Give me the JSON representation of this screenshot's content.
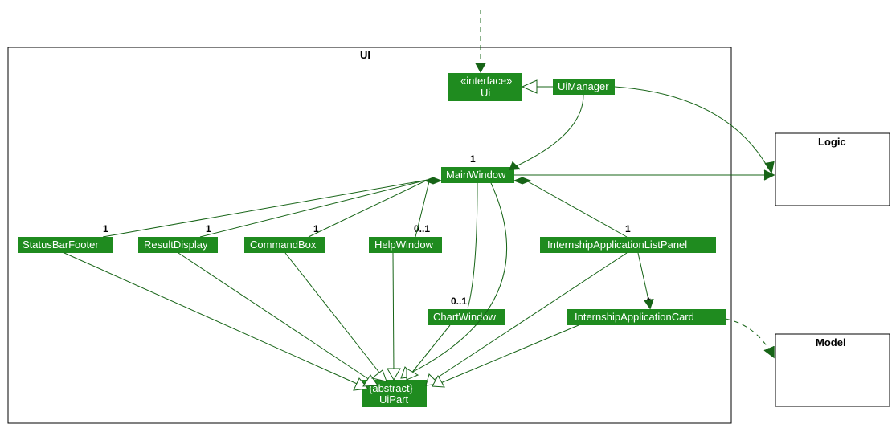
{
  "packages": {
    "ui": "UI",
    "logic": "Logic",
    "model": "Model"
  },
  "nodes": {
    "uiInterface": {
      "stereotype": "«interface»",
      "name": "Ui"
    },
    "uiManager": "UiManager",
    "mainWindow": "MainWindow",
    "statusBarFooter": "StatusBarFooter",
    "resultDisplay": "ResultDisplay",
    "commandBox": "CommandBox",
    "helpWindow": "HelpWindow",
    "internshipApplicationListPanel": "InternshipApplicationListPanel",
    "chartWindow": "ChartWindow",
    "internshipApplicationCard": "InternshipApplicationCard",
    "uiPart": {
      "stereotype": "{abstract}",
      "name": "UiPart"
    }
  },
  "multiplicities": {
    "mainWindow": "1",
    "statusBarFooter": "1",
    "resultDisplay": "1",
    "commandBox": "1",
    "helpWindow": "0..1",
    "internshipApplicationListPanel": "1",
    "chartWindow": "0..1",
    "internshipApplicationCard": "*"
  }
}
